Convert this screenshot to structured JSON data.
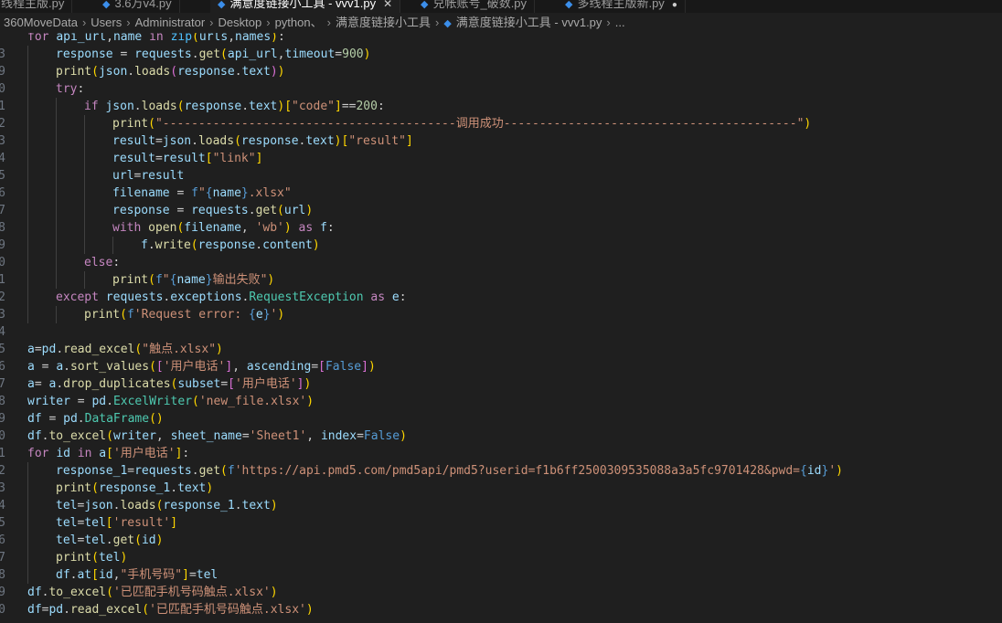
{
  "tabs": [
    {
      "label": "多线程主版.py",
      "active": false,
      "dirty": false
    },
    {
      "label": "3.6万v4.py",
      "active": false,
      "dirty": false
    },
    {
      "label": "满意度链接小工具 - vvv1.py",
      "active": true,
      "dirty": false
    },
    {
      "label": "兑帐账号_破数.py",
      "active": false,
      "dirty": false
    },
    {
      "label": "多线程主版新.py",
      "active": false,
      "dirty": true
    }
  ],
  "breadcrumb": [
    "360MoveData",
    "Users",
    "Administrator",
    "Desktop",
    "python、",
    "满意度链接小工具",
    "满意度链接小工具 - vvv1.py",
    "..."
  ],
  "code_lines": [
    {
      "n": "",
      "indent": 0,
      "segs": [
        [
          "kw",
          "for "
        ],
        [
          "vr",
          "api_url"
        ],
        [
          "pl",
          ","
        ],
        [
          "vr",
          "name"
        ],
        [
          "kw",
          " in "
        ],
        [
          "bi",
          "zip"
        ],
        [
          "br",
          "("
        ],
        [
          "vr",
          "urls"
        ],
        [
          "pl",
          ","
        ],
        [
          "vr",
          "names"
        ],
        [
          "br",
          ")"
        ],
        [
          "pl",
          ":"
        ]
      ]
    },
    {
      "n": "3",
      "indent": 1,
      "segs": [
        [
          "vr",
          "response"
        ],
        [
          "pl",
          " = "
        ],
        [
          "vr",
          "requests"
        ],
        [
          "pl",
          "."
        ],
        [
          "fn",
          "get"
        ],
        [
          "br",
          "("
        ],
        [
          "vr",
          "api_url"
        ],
        [
          "pl",
          ","
        ],
        [
          "vr",
          "timeout"
        ],
        [
          "pl",
          "="
        ],
        [
          "nu",
          "900"
        ],
        [
          "br",
          ")"
        ]
      ]
    },
    {
      "n": "9",
      "indent": 1,
      "segs": [
        [
          "fn",
          "print"
        ],
        [
          "br",
          "("
        ],
        [
          "vr",
          "json"
        ],
        [
          "pl",
          "."
        ],
        [
          "fn",
          "loads"
        ],
        [
          "br2",
          "("
        ],
        [
          "vr",
          "response"
        ],
        [
          "pl",
          "."
        ],
        [
          "vr",
          "text"
        ],
        [
          "br2",
          ")"
        ],
        [
          "br",
          ")"
        ]
      ]
    },
    {
      "n": "0",
      "indent": 1,
      "segs": [
        [
          "kw",
          "try"
        ],
        [
          "pl",
          ":"
        ]
      ]
    },
    {
      "n": "1",
      "indent": 2,
      "segs": [
        [
          "kw",
          "if "
        ],
        [
          "vr",
          "json"
        ],
        [
          "pl",
          "."
        ],
        [
          "fn",
          "loads"
        ],
        [
          "br",
          "("
        ],
        [
          "vr",
          "response"
        ],
        [
          "pl",
          "."
        ],
        [
          "vr",
          "text"
        ],
        [
          "br",
          ")"
        ],
        [
          "br",
          "["
        ],
        [
          "st",
          "\"code\""
        ],
        [
          "br",
          "]"
        ],
        [
          "pl",
          "=="
        ],
        [
          "nu",
          "200"
        ],
        [
          "pl",
          ":"
        ]
      ]
    },
    {
      "n": "2",
      "indent": 3,
      "segs": [
        [
          "fn",
          "print"
        ],
        [
          "br",
          "("
        ],
        [
          "st",
          "\"-----------------------------------------调用成功-----------------------------------------\""
        ],
        [
          "br",
          ")"
        ]
      ]
    },
    {
      "n": "3",
      "indent": 3,
      "segs": [
        [
          "vr",
          "result"
        ],
        [
          "pl",
          "="
        ],
        [
          "vr",
          "json"
        ],
        [
          "pl",
          "."
        ],
        [
          "fn",
          "loads"
        ],
        [
          "br",
          "("
        ],
        [
          "vr",
          "response"
        ],
        [
          "pl",
          "."
        ],
        [
          "vr",
          "text"
        ],
        [
          "br",
          ")"
        ],
        [
          "br",
          "["
        ],
        [
          "st",
          "\"result\""
        ],
        [
          "br",
          "]"
        ]
      ]
    },
    {
      "n": "4",
      "indent": 3,
      "segs": [
        [
          "vr",
          "result"
        ],
        [
          "pl",
          "="
        ],
        [
          "vr",
          "result"
        ],
        [
          "br",
          "["
        ],
        [
          "st",
          "\"link\""
        ],
        [
          "br",
          "]"
        ]
      ]
    },
    {
      "n": "5",
      "indent": 3,
      "segs": [
        [
          "vr",
          "url"
        ],
        [
          "pl",
          "="
        ],
        [
          "vr",
          "result"
        ]
      ]
    },
    {
      "n": "6",
      "indent": 3,
      "segs": [
        [
          "vr",
          "filename"
        ],
        [
          "pl",
          " = "
        ],
        [
          "cn",
          "f"
        ],
        [
          "st",
          "\""
        ],
        [
          "cn",
          "{"
        ],
        [
          "vr",
          "name"
        ],
        [
          "cn",
          "}"
        ],
        [
          "st",
          ".xlsx\""
        ]
      ]
    },
    {
      "n": "7",
      "indent": 3,
      "segs": [
        [
          "vr",
          "response"
        ],
        [
          "pl",
          " = "
        ],
        [
          "vr",
          "requests"
        ],
        [
          "pl",
          "."
        ],
        [
          "fn",
          "get"
        ],
        [
          "br",
          "("
        ],
        [
          "vr",
          "url"
        ],
        [
          "br",
          ")"
        ]
      ]
    },
    {
      "n": "8",
      "indent": 3,
      "segs": [
        [
          "kw",
          "with "
        ],
        [
          "fn",
          "open"
        ],
        [
          "br",
          "("
        ],
        [
          "vr",
          "filename"
        ],
        [
          "pl",
          ", "
        ],
        [
          "st",
          "'wb'"
        ],
        [
          "br",
          ")"
        ],
        [
          "kw",
          " as "
        ],
        [
          "vr",
          "f"
        ],
        [
          "pl",
          ":"
        ]
      ]
    },
    {
      "n": "9",
      "indent": 4,
      "segs": [
        [
          "vr",
          "f"
        ],
        [
          "pl",
          "."
        ],
        [
          "fn",
          "write"
        ],
        [
          "br",
          "("
        ],
        [
          "vr",
          "response"
        ],
        [
          "pl",
          "."
        ],
        [
          "vr",
          "content"
        ],
        [
          "br",
          ")"
        ]
      ]
    },
    {
      "n": "0",
      "indent": 2,
      "segs": [
        [
          "kw",
          "else"
        ],
        [
          "pl",
          ":"
        ]
      ]
    },
    {
      "n": "1",
      "indent": 3,
      "segs": [
        [
          "fn",
          "print"
        ],
        [
          "br",
          "("
        ],
        [
          "cn",
          "f"
        ],
        [
          "st",
          "\""
        ],
        [
          "cn",
          "{"
        ],
        [
          "vr",
          "name"
        ],
        [
          "cn",
          "}"
        ],
        [
          "st",
          "输出失败\""
        ],
        [
          "br",
          ")"
        ]
      ]
    },
    {
      "n": "2",
      "indent": 1,
      "segs": [
        [
          "kw",
          "except "
        ],
        [
          "vr",
          "requests"
        ],
        [
          "pl",
          "."
        ],
        [
          "vr",
          "exceptions"
        ],
        [
          "pl",
          "."
        ],
        [
          "cl",
          "RequestException"
        ],
        [
          "kw",
          " as "
        ],
        [
          "vr",
          "e"
        ],
        [
          "pl",
          ":"
        ]
      ]
    },
    {
      "n": "3",
      "indent": 2,
      "segs": [
        [
          "fn",
          "print"
        ],
        [
          "br",
          "("
        ],
        [
          "cn",
          "f"
        ],
        [
          "st",
          "'Request error: "
        ],
        [
          "cn",
          "{"
        ],
        [
          "vr",
          "e"
        ],
        [
          "cn",
          "}"
        ],
        [
          "st",
          "'"
        ],
        [
          "br",
          ")"
        ]
      ]
    },
    {
      "n": "4",
      "indent": 0,
      "segs": []
    },
    {
      "n": "5",
      "indent": 0,
      "segs": [
        [
          "vr",
          "a"
        ],
        [
          "pl",
          "="
        ],
        [
          "vr",
          "pd"
        ],
        [
          "pl",
          "."
        ],
        [
          "fn",
          "read_excel"
        ],
        [
          "br",
          "("
        ],
        [
          "st",
          "\"触点.xlsx\""
        ],
        [
          "br",
          ")"
        ]
      ]
    },
    {
      "n": "6",
      "indent": 0,
      "segs": [
        [
          "vr",
          "a"
        ],
        [
          "pl",
          " = "
        ],
        [
          "vr",
          "a"
        ],
        [
          "pl",
          "."
        ],
        [
          "fn",
          "sort_values"
        ],
        [
          "br",
          "("
        ],
        [
          "br2",
          "["
        ],
        [
          "st",
          "'用户电话'"
        ],
        [
          "br2",
          "]"
        ],
        [
          "pl",
          ", "
        ],
        [
          "vr",
          "ascending"
        ],
        [
          "pl",
          "="
        ],
        [
          "br2",
          "["
        ],
        [
          "cn",
          "False"
        ],
        [
          "br2",
          "]"
        ],
        [
          "br",
          ")"
        ]
      ]
    },
    {
      "n": "7",
      "indent": 0,
      "segs": [
        [
          "vr",
          "a"
        ],
        [
          "pl",
          "= "
        ],
        [
          "vr",
          "a"
        ],
        [
          "pl",
          "."
        ],
        [
          "fn",
          "drop_duplicates"
        ],
        [
          "br",
          "("
        ],
        [
          "vr",
          "subset"
        ],
        [
          "pl",
          "="
        ],
        [
          "br2",
          "["
        ],
        [
          "st",
          "'用户电话'"
        ],
        [
          "br2",
          "]"
        ],
        [
          "br",
          ")"
        ]
      ]
    },
    {
      "n": "8",
      "indent": 0,
      "segs": [
        [
          "vr",
          "writer"
        ],
        [
          "pl",
          " = "
        ],
        [
          "vr",
          "pd"
        ],
        [
          "pl",
          "."
        ],
        [
          "cl",
          "ExcelWriter"
        ],
        [
          "br",
          "("
        ],
        [
          "st",
          "'new_file.xlsx'"
        ],
        [
          "br",
          ")"
        ]
      ]
    },
    {
      "n": "9",
      "indent": 0,
      "segs": [
        [
          "vr",
          "df"
        ],
        [
          "pl",
          " = "
        ],
        [
          "vr",
          "pd"
        ],
        [
          "pl",
          "."
        ],
        [
          "cl",
          "DataFrame"
        ],
        [
          "br",
          "("
        ],
        [
          "br",
          ")"
        ]
      ]
    },
    {
      "n": "0",
      "indent": 0,
      "segs": [
        [
          "vr",
          "df"
        ],
        [
          "pl",
          "."
        ],
        [
          "fn",
          "to_excel"
        ],
        [
          "br",
          "("
        ],
        [
          "vr",
          "writer"
        ],
        [
          "pl",
          ", "
        ],
        [
          "vr",
          "sheet_name"
        ],
        [
          "pl",
          "="
        ],
        [
          "st",
          "'Sheet1'"
        ],
        [
          "pl",
          ", "
        ],
        [
          "vr",
          "index"
        ],
        [
          "pl",
          "="
        ],
        [
          "cn",
          "False"
        ],
        [
          "br",
          ")"
        ]
      ]
    },
    {
      "n": "1",
      "indent": 0,
      "segs": [
        [
          "kw",
          "for "
        ],
        [
          "vr",
          "id"
        ],
        [
          "kw",
          " in "
        ],
        [
          "vr",
          "a"
        ],
        [
          "br",
          "["
        ],
        [
          "st",
          "'用户电话'"
        ],
        [
          "br",
          "]"
        ],
        [
          "pl",
          ":"
        ]
      ]
    },
    {
      "n": "2",
      "indent": 1,
      "segs": [
        [
          "vr",
          "response_1"
        ],
        [
          "pl",
          "="
        ],
        [
          "vr",
          "requests"
        ],
        [
          "pl",
          "."
        ],
        [
          "fn",
          "get"
        ],
        [
          "br",
          "("
        ],
        [
          "cn",
          "f"
        ],
        [
          "st",
          "'https://api.pmd5.com/pmd5api/pmd5?userid=f1b6ff2500309535088a3a5fc9701428&pwd="
        ],
        [
          "cn",
          "{"
        ],
        [
          "vr",
          "id"
        ],
        [
          "cn",
          "}"
        ],
        [
          "st",
          "'"
        ],
        [
          "br",
          ")"
        ]
      ]
    },
    {
      "n": "3",
      "indent": 1,
      "segs": [
        [
          "fn",
          "print"
        ],
        [
          "br",
          "("
        ],
        [
          "vr",
          "response_1"
        ],
        [
          "pl",
          "."
        ],
        [
          "vr",
          "text"
        ],
        [
          "br",
          ")"
        ]
      ]
    },
    {
      "n": "4",
      "indent": 1,
      "segs": [
        [
          "vr",
          "tel"
        ],
        [
          "pl",
          "="
        ],
        [
          "vr",
          "json"
        ],
        [
          "pl",
          "."
        ],
        [
          "fn",
          "loads"
        ],
        [
          "br",
          "("
        ],
        [
          "vr",
          "response_1"
        ],
        [
          "pl",
          "."
        ],
        [
          "vr",
          "text"
        ],
        [
          "br",
          ")"
        ]
      ]
    },
    {
      "n": "5",
      "indent": 1,
      "segs": [
        [
          "vr",
          "tel"
        ],
        [
          "pl",
          "="
        ],
        [
          "vr",
          "tel"
        ],
        [
          "br",
          "["
        ],
        [
          "st",
          "'result'"
        ],
        [
          "br",
          "]"
        ]
      ]
    },
    {
      "n": "6",
      "indent": 1,
      "segs": [
        [
          "vr",
          "tel"
        ],
        [
          "pl",
          "="
        ],
        [
          "vr",
          "tel"
        ],
        [
          "pl",
          "."
        ],
        [
          "fn",
          "get"
        ],
        [
          "br",
          "("
        ],
        [
          "vr",
          "id"
        ],
        [
          "br",
          ")"
        ]
      ]
    },
    {
      "n": "7",
      "indent": 1,
      "segs": [
        [
          "fn",
          "print"
        ],
        [
          "br",
          "("
        ],
        [
          "vr",
          "tel"
        ],
        [
          "br",
          ")"
        ]
      ]
    },
    {
      "n": "8",
      "indent": 1,
      "segs": [
        [
          "vr",
          "df"
        ],
        [
          "pl",
          "."
        ],
        [
          "vr",
          "at"
        ],
        [
          "br",
          "["
        ],
        [
          "vr",
          "id"
        ],
        [
          "pl",
          ","
        ],
        [
          "st",
          "\"手机号码\""
        ],
        [
          "br",
          "]"
        ],
        [
          "pl",
          "="
        ],
        [
          "vr",
          "tel"
        ]
      ]
    },
    {
      "n": "9",
      "indent": 0,
      "segs": [
        [
          "vr",
          "df"
        ],
        [
          "pl",
          "."
        ],
        [
          "fn",
          "to_excel"
        ],
        [
          "br",
          "("
        ],
        [
          "st",
          "'已匹配手机号码触点.xlsx'"
        ],
        [
          "br",
          ")"
        ]
      ]
    },
    {
      "n": "0",
      "indent": 0,
      "segs": [
        [
          "vr",
          "df"
        ],
        [
          "pl",
          "="
        ],
        [
          "vr",
          "pd"
        ],
        [
          "pl",
          "."
        ],
        [
          "fn",
          "read_excel"
        ],
        [
          "br",
          "("
        ],
        [
          "st",
          "'已匹配手机号码触点.xlsx'"
        ],
        [
          "br",
          ")"
        ]
      ]
    }
  ]
}
